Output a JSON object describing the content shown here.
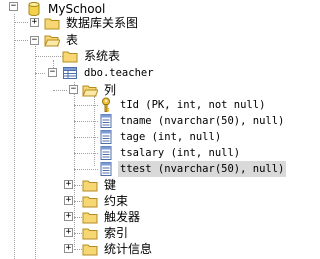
{
  "tree": {
    "database": "MySchool",
    "diagrams": "数据库关系图",
    "tables": "表",
    "system_tables": "系统表",
    "table_name": "dbo.teacher",
    "columns_folder": "列",
    "columns": [
      "tId (PK, int, not null)",
      "tname (nvarchar(50), null)",
      "tage (int, null)",
      "tsalary (int, null)",
      "ttest (nvarchar(50), null)"
    ],
    "sub_folders": [
      "键",
      "约束",
      "触发器",
      "索引",
      "统计信息"
    ]
  }
}
